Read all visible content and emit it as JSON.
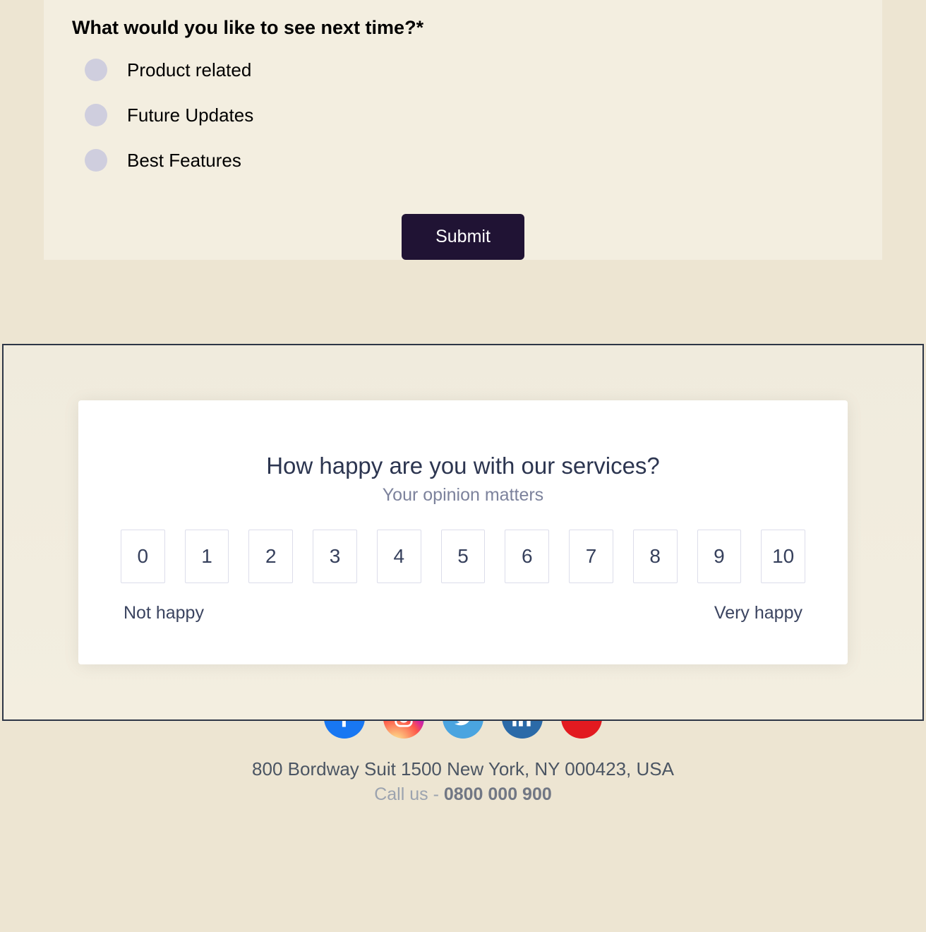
{
  "question": {
    "label": "What would you like to see next time?*",
    "options": [
      "Product related",
      "Future Updates",
      "Best Features"
    ]
  },
  "submit_label": "Submit",
  "nps": {
    "title": "How happy are you with our services?",
    "subtitle": "Your opinion matters",
    "values": [
      "0",
      "1",
      "2",
      "3",
      "4",
      "5",
      "6",
      "7",
      "8",
      "9",
      "10"
    ],
    "low_label": "Not happy",
    "high_label": "Very happy"
  },
  "footer": {
    "social": [
      "facebook",
      "instagram",
      "twitter",
      "linkedin",
      "youtube"
    ],
    "address": "800 Bordway Suit 1500 New York, NY 000423, USA",
    "call_prefix": "Call us - ",
    "call_number": "0800 000 900"
  }
}
